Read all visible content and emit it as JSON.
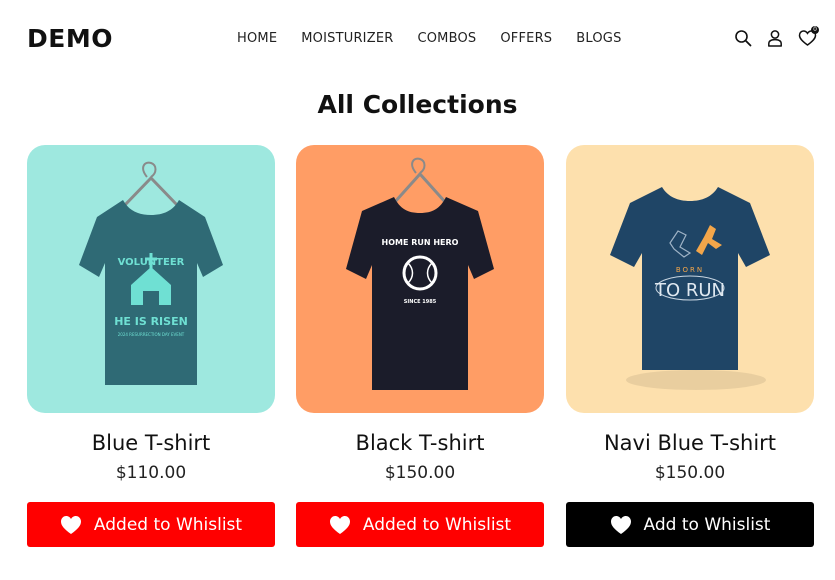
{
  "header": {
    "logo": "DEMO",
    "nav": [
      "HOME",
      "MOISTURIZER",
      "COMBOS",
      "OFFERS",
      "BLOGS"
    ],
    "icons": [
      "search-icon",
      "user-icon",
      "wishlist-heart-icon"
    ],
    "wishlist_count": "0"
  },
  "page_title": "All Collections",
  "products": [
    {
      "name": "Blue T-shirt",
      "price": "$110.00",
      "button": "Added  to Whislist",
      "bg": "#9ee8df",
      "shirt_color": "#2f6a75",
      "print_color": "#6fe0d3",
      "print_lines": [
        "VOLUNTEER",
        "HE IS RISEN",
        "2024 RESURRECTION DAY EVENT"
      ],
      "button_color": "#ff0000"
    },
    {
      "name": "Black T-shirt",
      "price": "$150.00",
      "button": "Added  to Whislist",
      "bg": "#ff9d65",
      "shirt_color": "#1b1c2a",
      "print_color": "#ffffff",
      "print_lines": [
        "HOME RUN HERO",
        "SINCE 1985"
      ],
      "button_color": "#ff0000"
    },
    {
      "name": "Navi Blue T-shirt",
      "price": "$150.00",
      "button": "Add to Whislist",
      "bg": "#fde0ad",
      "shirt_color": "#1f4566",
      "print_color": "#f3a64a",
      "print_lines": [
        "BORN",
        "TO RUN"
      ],
      "button_color": "#000000"
    }
  ]
}
